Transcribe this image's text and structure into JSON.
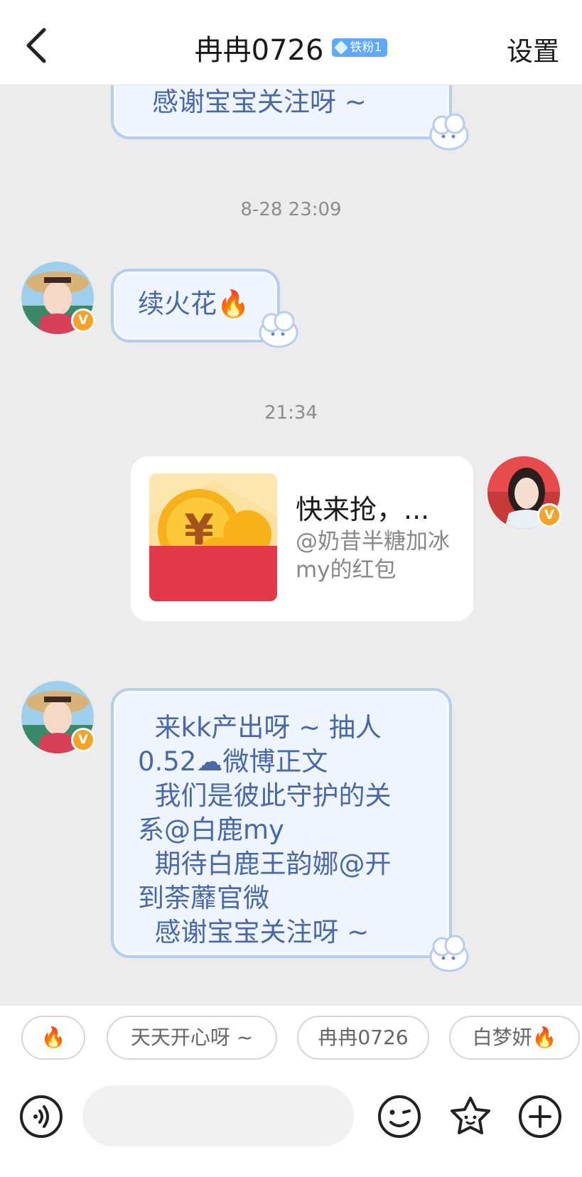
{
  "header": {
    "back_icon": "chevron-left-icon",
    "title": "冉冉0726",
    "badge": "铁粉1",
    "settings": "设置"
  },
  "messages": {
    "top_partial": "感谢宝宝关注呀 ~",
    "time1": "8-28 23:09",
    "msg1": "续火花🔥",
    "time2": "21:34",
    "red_packet": {
      "title": "快来抢，...",
      "subtitle": "@奶昔半糖加冰my的红包"
    },
    "msg2": "  来kk产出呀 ~ 抽人\n0.52☁微博正文\n  我们是彼此守护的关\n系@白鹿my\n  期待白鹿王韵娜@开\n到荼蘼官微\n  感谢宝宝关注呀 ~"
  },
  "quick_replies": [
    "🔥",
    "天天开心呀 ~",
    "冉冉0726",
    "白梦妍🔥"
  ],
  "input_bar": {
    "voice_icon": "voice-icon",
    "placeholder": "",
    "emoji_icon": "emoji-icon",
    "star_icon": "star-face-icon",
    "add_icon": "plus-circle-icon"
  },
  "colors": {
    "bubble_bg": "#eef5ff",
    "bubble_border": "#b6cdee",
    "bubble_text": "#4a67a8",
    "verified_badge": "#f5a12a",
    "fan_badge": "#5fa7ff",
    "red_packet": "#e23a4a"
  }
}
